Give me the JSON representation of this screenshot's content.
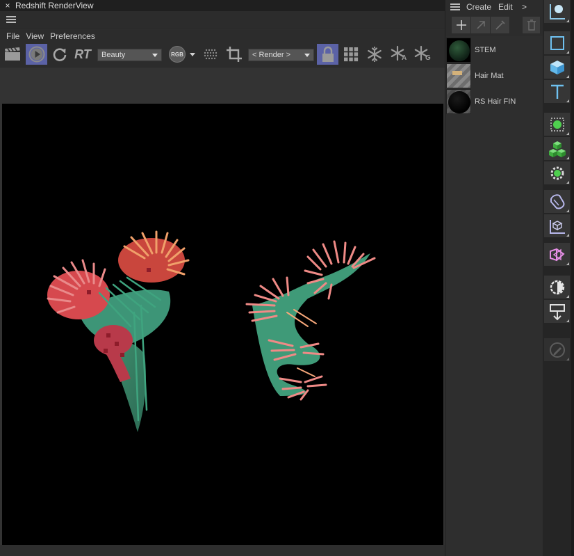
{
  "window": {
    "close_glyph": "×",
    "title": "Redshift RenderView"
  },
  "menu": [
    "File",
    "View",
    "Preferences"
  ],
  "toolbar": {
    "rt_label": "RT",
    "aov_value": "Beauty",
    "rgb_label": "RGB",
    "camera_value": "< Render >",
    "snapshot_a": "A",
    "snapshot_g": "G",
    "accent": "#5b62a6"
  },
  "materials": {
    "menu": {
      "create": "Create",
      "edit": "Edit",
      "more": ">"
    },
    "items": [
      {
        "name": "STEM"
      },
      {
        "name": "Hair Mat"
      },
      {
        "name": "RS Hair FIN"
      }
    ]
  },
  "palette": {
    "icons": [
      "null-object-icon",
      "cube-outline-icon",
      "cube-icon",
      "text-icon",
      "cloner-icon",
      "generator-icon",
      "gear-effector-icon",
      "deformer-icon",
      "coordinate-icon",
      "scene-icon",
      "light-icon",
      "tag-icon",
      "pencil-icon"
    ]
  }
}
